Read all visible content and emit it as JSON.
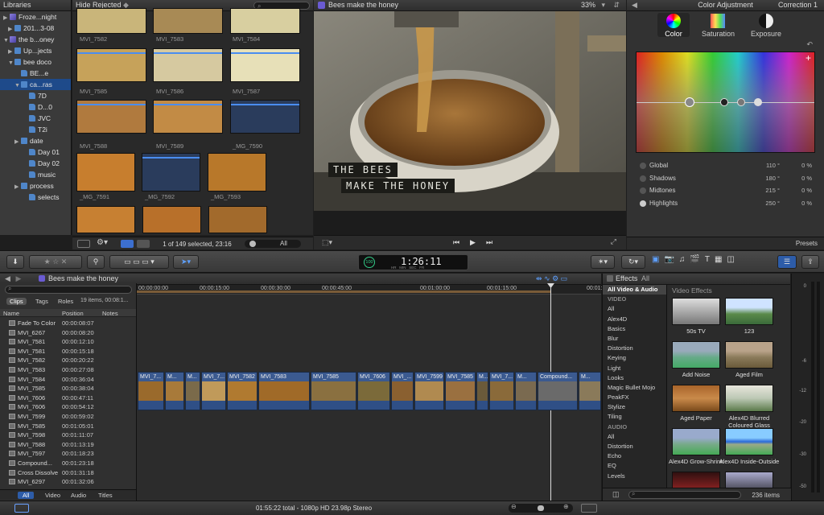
{
  "library": {
    "header": "Libraries",
    "items": [
      {
        "label": "Froze...night",
        "icon": "library"
      },
      {
        "label": "201...3-08",
        "icon": "event"
      },
      {
        "label": "the b...oney",
        "icon": "library"
      },
      {
        "label": "Up...jects",
        "icon": "event"
      },
      {
        "label": "bee doco",
        "icon": "event"
      },
      {
        "label": "BE...e",
        "icon": "keyword"
      },
      {
        "label": "ca...ras",
        "icon": "folder"
      },
      {
        "label": "7D",
        "icon": "keyword"
      },
      {
        "label": "D...0",
        "icon": "keyword"
      },
      {
        "label": "JVC",
        "icon": "keyword"
      },
      {
        "label": "T2i",
        "icon": "keyword"
      },
      {
        "label": "date",
        "icon": "folder"
      },
      {
        "label": "Day 01",
        "icon": "keyword"
      },
      {
        "label": "Day 02",
        "icon": "keyword"
      },
      {
        "label": "music",
        "icon": "keyword"
      },
      {
        "label": "process",
        "icon": "folder"
      },
      {
        "label": "selects",
        "icon": "keyword"
      }
    ]
  },
  "browser": {
    "filter": "Hide Rejected",
    "clips": [
      "MVI_7582",
      "MVI_7583",
      "MVI_7584",
      "MVI_7585",
      "MVI_7586",
      "MVI_7587",
      "MVI_7588",
      "MVI_7589",
      "_MG_7590",
      "_MG_7591",
      "_MG_7592",
      "_MG_7593"
    ],
    "status": "1 of 149 selected, 23:16",
    "view_filter": "All"
  },
  "viewer": {
    "title": "Bees make the honey",
    "zoom": "33%",
    "caption_line1": "THE BEES",
    "caption_line2": "MAKE THE HONEY"
  },
  "inspector": {
    "title": "Color Adjustment",
    "correction": "Correction 1",
    "tabs": [
      "Color",
      "Saturation",
      "Exposure"
    ],
    "rows": [
      {
        "name": "Global",
        "deg": "110 °",
        "pct": "0 %"
      },
      {
        "name": "Shadows",
        "deg": "180 °",
        "pct": "0 %"
      },
      {
        "name": "Midtones",
        "deg": "215 °",
        "pct": "0 %"
      },
      {
        "name": "Highlights",
        "deg": "250 °",
        "pct": "0 %"
      }
    ],
    "presets": "Presets"
  },
  "toolbar": {
    "timecode": "1:26:11",
    "tc_sub": "HR   MIN   SEC   FR",
    "percent": "100"
  },
  "timeline": {
    "project": "Bees make the honey",
    "ruler": [
      "00:00:00:00",
      "00:00:15:00",
      "00:00:30:00",
      "00:00:45:00",
      "00:01:00:00",
      "00:01:15:00",
      "00:01:30"
    ],
    "clip_names": [
      "MVI_7...",
      "M...",
      "M...",
      "MVI_7...",
      "MVI_7582",
      "MVI_7583",
      "MVI_7585",
      "MVI_7606",
      "MVI_...",
      "MVI_7599",
      "MVI_7585",
      "M...",
      "MVI_7...",
      "M...",
      "Compound...",
      "M..."
    ]
  },
  "index": {
    "tabs": [
      "Clips",
      "Tags",
      "Roles"
    ],
    "summary": "19 items, 00:08:1...",
    "cols": [
      "Name",
      "Position",
      "Notes"
    ],
    "rows": [
      [
        "Fade To Color",
        "00:00:08:07"
      ],
      [
        "MVI_6267",
        "00:00:08:20"
      ],
      [
        "MVI_7581",
        "00:00:12:10"
      ],
      [
        "MVI_7581",
        "00:00:15:18"
      ],
      [
        "MVI_7582",
        "00:00:20:22"
      ],
      [
        "MVI_7583",
        "00:00:27:08"
      ],
      [
        "MVI_7584",
        "00:00:36:04"
      ],
      [
        "MVI_7585",
        "00:00:38:04"
      ],
      [
        "MVI_7606",
        "00:00:47:11"
      ],
      [
        "MVI_7606",
        "00:00:54:12"
      ],
      [
        "MVI_7599",
        "00:00:59:02"
      ],
      [
        "MVI_7585",
        "00:01:05:01"
      ],
      [
        "MVI_7598",
        "00:01:11:07"
      ],
      [
        "MVI_7588",
        "00:01:13:19"
      ],
      [
        "MVI_7597",
        "00:01:18:23"
      ],
      [
        "Compound...",
        "00:01:23:18"
      ],
      [
        "Cross Dissolve",
        "00:01:31:18"
      ],
      [
        "MVI_6297",
        "00:01:32:06"
      ]
    ],
    "bottom_tabs": [
      "All",
      "Video",
      "Audio",
      "Titles"
    ]
  },
  "effects": {
    "title": "Effects",
    "filter": "All",
    "section": "Video Effects",
    "categories": [
      "All Video & Audio",
      "VIDEO",
      "All",
      "Alex4D",
      "Basics",
      "Blur",
      "Distortion",
      "Keying",
      "Light",
      "Looks",
      "Magic Bullet Mojo",
      "PeakFX",
      "Stylize",
      "Tiling",
      "AUDIO",
      "All",
      "Distortion",
      "Echo",
      "EQ",
      "Levels"
    ],
    "items": [
      "50s TV",
      "123",
      "Add Noise",
      "Aged Film",
      "Aged Paper",
      "Alex4D Blurred Coloured Glass",
      "Alex4D Grow-Shrink",
      "Alex4D Inside-Outside"
    ],
    "count": "236 items"
  },
  "meter": {
    "ticks": [
      "0",
      "-6",
      "-12",
      "-20",
      "-30",
      "-50"
    ]
  },
  "footer": {
    "status": "01:55:22 total - 1080p HD 23.98p Stereo"
  }
}
